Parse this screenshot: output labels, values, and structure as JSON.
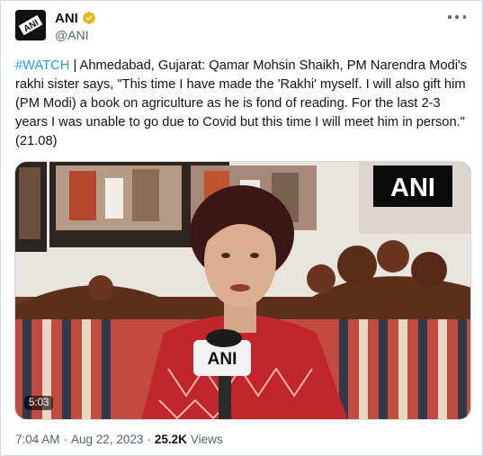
{
  "author": {
    "name": "ANI",
    "handle": "@ANI",
    "avatar_text": "ANI",
    "verified_color": "#e2b719"
  },
  "tweet": {
    "hashtag": "#WATCH",
    "text": " | Ahmedabad, Gujarat: Qamar Mohsin Shaikh, PM Narendra Modi's rakhi sister says, \"This time I have made the 'Rakhi' myself. I will also gift him (PM Modi) a book on agriculture as he is fond of reading. For the last 2-3 years I was unable to go due to Covid but this time I will meet him in person.\" (21.08)"
  },
  "media": {
    "watermark": "ANI",
    "mic_label": "ANI",
    "duration": "5:03"
  },
  "meta": {
    "time": "7:04 AM",
    "date": "Aug 22, 2023",
    "views_count": "25.2K",
    "views_label": "Views"
  },
  "colors": {
    "link": "#1d9bf0",
    "secondary_text": "#536471"
  },
  "icons": [
    "ani-logo-icon",
    "verified-badge-icon",
    "more-options-icon"
  ]
}
